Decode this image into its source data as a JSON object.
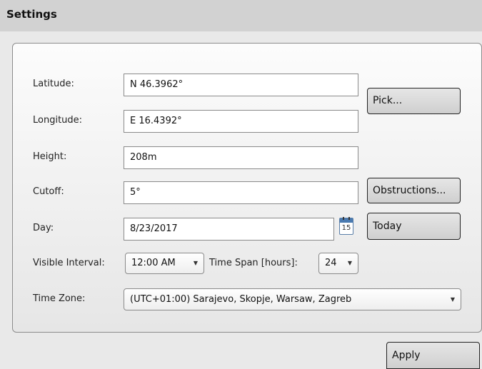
{
  "header": {
    "title": "Settings"
  },
  "form": {
    "latitude": {
      "label": "Latitude:",
      "value": "N 46.3962°"
    },
    "longitude": {
      "label": "Longitude:",
      "value": "E 16.4392°"
    },
    "height": {
      "label": "Height:",
      "value": "208m"
    },
    "cutoff": {
      "label": "Cutoff:",
      "value": "5°"
    },
    "day": {
      "label": "Day:",
      "value": "8/23/2017",
      "calendar_day": "15"
    },
    "visible_interval": {
      "label": "Visible Interval:",
      "value": "12:00 AM"
    },
    "time_span": {
      "label": "Time Span [hours]:",
      "value": "24"
    },
    "time_zone": {
      "label": "Time Zone:",
      "value": "(UTC+01:00) Sarajevo, Skopje, Warsaw, Zagreb"
    }
  },
  "buttons": {
    "pick": "Pick...",
    "obstructions": "Obstructions...",
    "today": "Today",
    "apply": "Apply"
  },
  "icons": {
    "dropdown": "chevron-down-icon",
    "calendar": "calendar-icon"
  }
}
